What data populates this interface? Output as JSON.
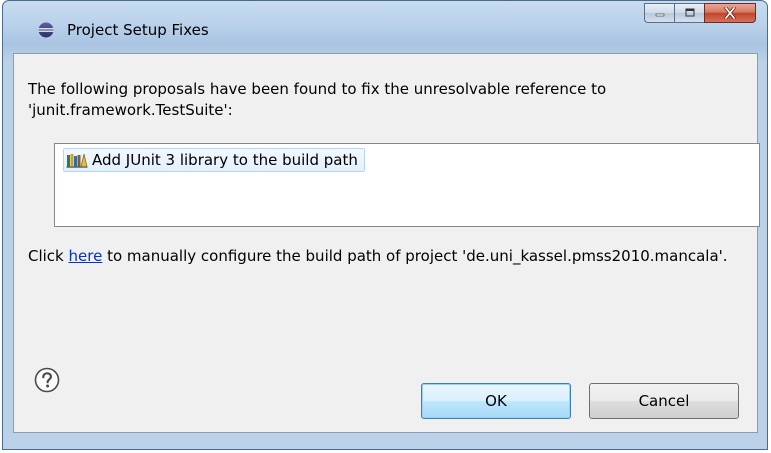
{
  "window": {
    "title": "Project Setup Fixes",
    "caption_buttons": [
      "minimize-icon",
      "maximize-icon",
      "close-icon"
    ]
  },
  "message": "The following proposals have been found to fix the unresolvable reference to 'junit.framework.TestSuite':",
  "proposals": [
    {
      "label": "Add JUnit 3 library to the build path",
      "icon": "library-icon",
      "selected": true
    }
  ],
  "config": {
    "prefix": "Click ",
    "link_text": "here",
    "suffix": " to manually configure the build path of project 'de.uni_kassel.pmss2010.mancala'."
  },
  "buttons": {
    "ok": "OK",
    "cancel": "Cancel"
  },
  "icons": {
    "help": "help-icon",
    "title": "eclipse-icon"
  },
  "colors": {
    "link": "#0033cc",
    "selection_border": "#b6d7f2",
    "default_button_border": "#3c7fb1"
  }
}
